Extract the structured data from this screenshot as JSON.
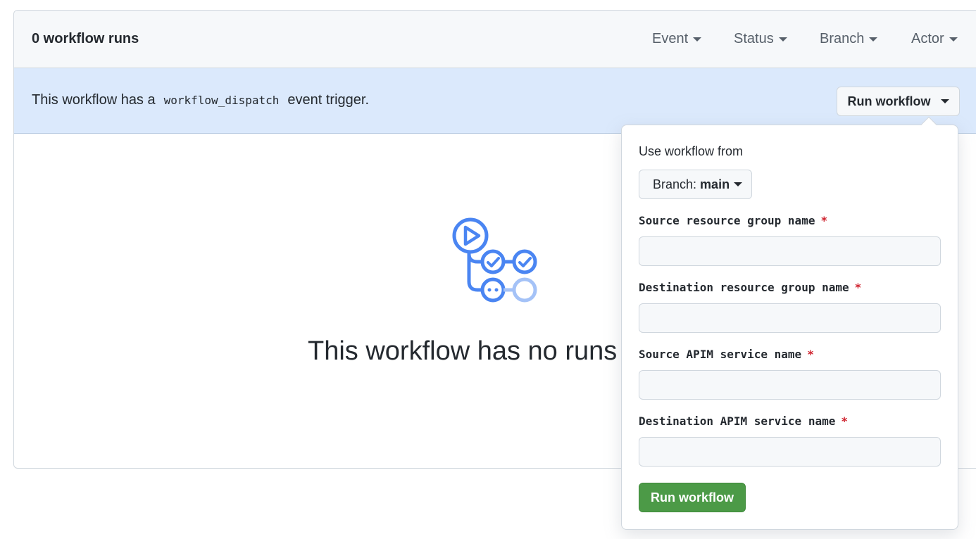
{
  "header": {
    "runs_count": "0 workflow runs",
    "filters": [
      {
        "label": "Event",
        "icon": "caret-down-icon"
      },
      {
        "label": "Status",
        "icon": "caret-down-icon"
      },
      {
        "label": "Branch",
        "icon": "caret-down-icon"
      },
      {
        "label": "Actor",
        "icon": "caret-down-icon"
      }
    ]
  },
  "banner": {
    "text_before": "This workflow has a",
    "code": "workflow_dispatch",
    "text_after": "event trigger.",
    "run_button": "Run workflow"
  },
  "empty_state": {
    "icon": "workflow-icon",
    "title": "This workflow has no runs yet."
  },
  "popover": {
    "use_from_label": "Use workflow from",
    "branch_prefix": "Branch:",
    "branch_value": "main",
    "fields": [
      {
        "label": "Source resource group name",
        "required": "*",
        "value": ""
      },
      {
        "label": "Destination resource group name",
        "required": "*",
        "value": ""
      },
      {
        "label": "Source APIM service name",
        "required": "*",
        "value": ""
      },
      {
        "label": "Destination APIM service name",
        "required": "*",
        "value": ""
      }
    ],
    "submit": "Run workflow"
  },
  "colors": {
    "banner_bg": "#dbe9fc",
    "primary_button": "#4c9a47",
    "icon_blue": "#4a85f2",
    "required": "#cf222e"
  }
}
